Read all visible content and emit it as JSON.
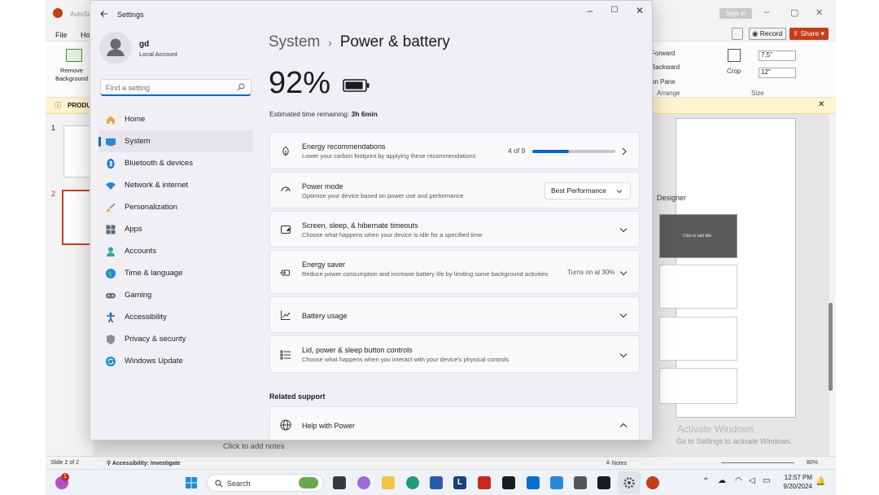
{
  "powerpoint": {
    "title_partial": "AutoSa",
    "sign_in": "Sign in",
    "menu": [
      "File",
      "Ho"
    ],
    "ribbon": {
      "remove_bg": "Remove\nBackground",
      "forward": "Forward",
      "backward": "Backward",
      "on_pane": "on Pane",
      "arrange": "Arrange",
      "crop": "Crop",
      "size": "Size",
      "width": "7.5\"",
      "height": "12\"",
      "record": "Record",
      "share": "Share"
    },
    "infobar_text": "PRODU",
    "slide_numbers": [
      "1",
      "2"
    ],
    "designer_title": "Designer",
    "designer_thumb_text": "Click to add title",
    "notes_placeholder": "Click to add notes",
    "status": {
      "slide": "Slide 2 of 2",
      "accessibility": "Accessibility: Investigate",
      "notes": "Notes",
      "zoom": "80%"
    },
    "activate_title": "Activate Windows",
    "activate_sub": "Go to Settings to activate Windows."
  },
  "settings": {
    "window_title": "Settings",
    "user_name": "gd",
    "account_type": "Local Account",
    "search_placeholder": "Find a setting",
    "nav": [
      {
        "label": "Home",
        "icon": "home-icon"
      },
      {
        "label": "System",
        "icon": "system-icon",
        "active": true
      },
      {
        "label": "Bluetooth & devices",
        "icon": "bluetooth-icon"
      },
      {
        "label": "Network & internet",
        "icon": "wifi-icon"
      },
      {
        "label": "Personalization",
        "icon": "brush-icon"
      },
      {
        "label": "Apps",
        "icon": "apps-icon"
      },
      {
        "label": "Accounts",
        "icon": "accounts-icon"
      },
      {
        "label": "Time & language",
        "icon": "globe-icon"
      },
      {
        "label": "Gaming",
        "icon": "gaming-icon"
      },
      {
        "label": "Accessibility",
        "icon": "accessibility-icon"
      },
      {
        "label": "Privacy & security",
        "icon": "shield-icon"
      },
      {
        "label": "Windows Update",
        "icon": "update-icon"
      }
    ],
    "breadcrumb_root": "System",
    "breadcrumb_sep": "›",
    "breadcrumb_current": "Power & battery",
    "battery_percent": "92%",
    "battery_level": 0.92,
    "est_label": "Estimated time remaining:",
    "est_value": "3h 6min",
    "cards": {
      "energy": {
        "title": "Energy recommendations",
        "sub": "Lower your carbon footprint by applying these recommendations",
        "progress_text": "4 of 9",
        "progress": 0.44
      },
      "power_mode": {
        "title": "Power mode",
        "sub": "Optimize your device based on power use and performance",
        "value": "Best Performance"
      },
      "screen": {
        "title": "Screen, sleep, & hibernate timeouts",
        "sub": "Choose what happens when your device is idle for a specified time"
      },
      "saver": {
        "title": "Energy saver",
        "sub": "Reduce power consumption and increase battery life by limiting some background activities",
        "status": "Turns on at 30%"
      },
      "usage": {
        "title": "Battery usage"
      },
      "lid": {
        "title": "Lid, power & sleep button controls",
        "sub": "Choose what happens when you interact with your device's physical controls"
      }
    },
    "related_heading": "Related support",
    "help_power": "Help with Power"
  },
  "taskbar": {
    "search": "Search",
    "time": "12:57 PM",
    "date": "9/20/2024",
    "notif_count": "1"
  }
}
